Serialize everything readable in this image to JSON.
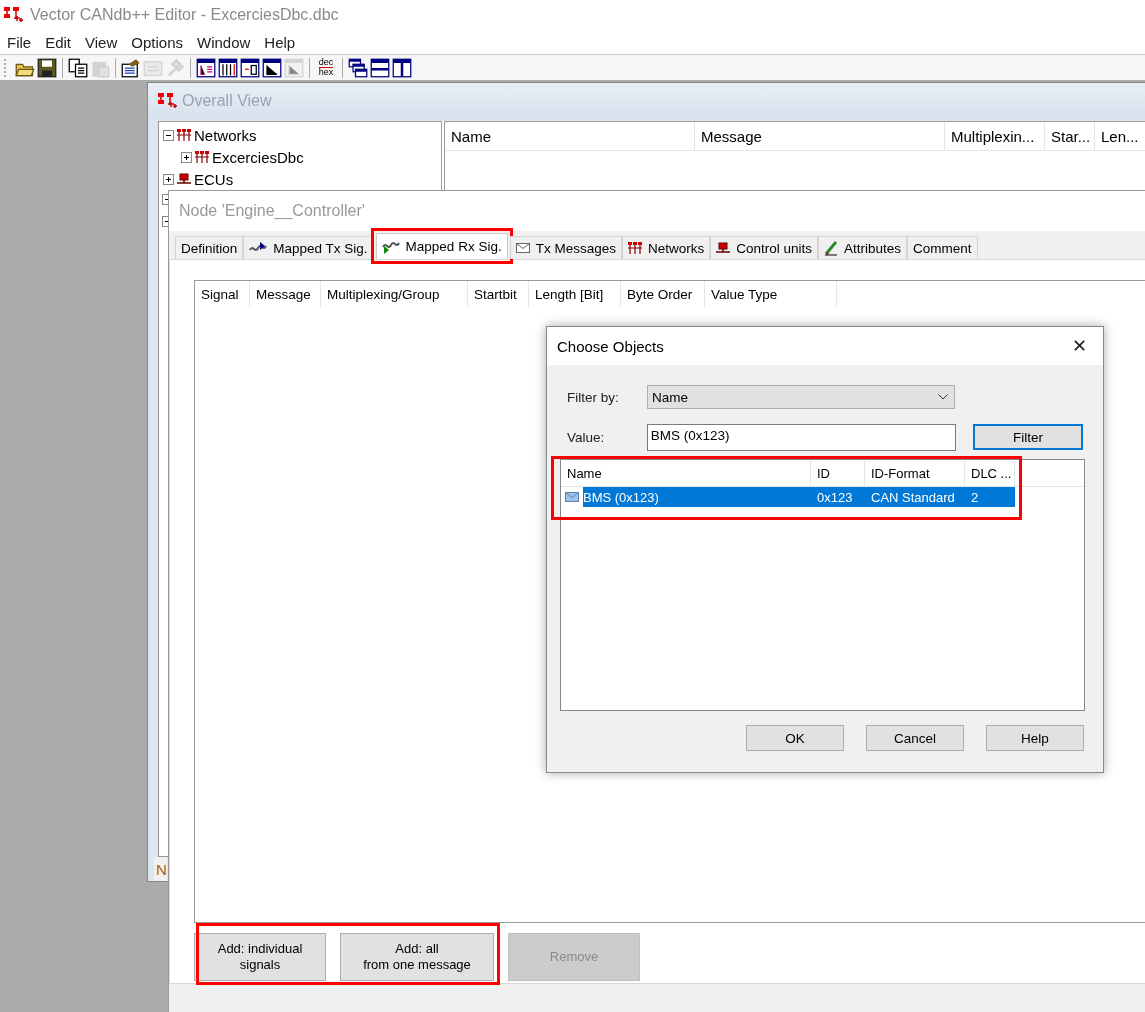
{
  "app_window": {
    "title": "Vector CANdb++ Editor - ExcerciesDbc.dbc"
  },
  "menu": [
    "File",
    "Edit",
    "View",
    "Options",
    "Window",
    "Help"
  ],
  "toolbar": {
    "groups": [
      [
        {
          "disabled": false
        },
        {
          "disabled": false
        }
      ],
      [
        {
          "disabled": false
        },
        {
          "disabled": true
        }
      ],
      [
        {
          "disabled": false
        },
        {
          "disabled": true
        },
        {
          "disabled": true
        }
      ],
      [
        {
          "disabled": false
        },
        {
          "disabled": false
        },
        {
          "disabled": false
        },
        {
          "disabled": false
        },
        {
          "disabled": true
        }
      ],
      [
        {
          "label_top": "dec",
          "label_bottom": "hex",
          "disabled": false
        }
      ],
      [
        {
          "disabled": false
        },
        {
          "disabled": false
        },
        {
          "disabled": false
        }
      ]
    ]
  },
  "overall_view": {
    "title": "Overall View",
    "tree": [
      {
        "label": "Networks",
        "expanded": true,
        "children": [
          {
            "label": "ExcerciesDbc",
            "expanded": false
          }
        ]
      },
      {
        "label": "ECUs",
        "expanded": false
      }
    ],
    "columns": [
      "Name",
      "Message",
      "Multiplexin...",
      "Star...",
      "Len..."
    ],
    "bottom_tab": "N"
  },
  "node_window": {
    "title": "Node 'Engine__Controller'",
    "tabs": [
      {
        "label": "Definition",
        "selected": false,
        "highlighted": false
      },
      {
        "label": "Mapped Tx Sig.",
        "selected": false,
        "highlighted": false
      },
      {
        "label": "Mapped Rx Sig.",
        "selected": true,
        "highlighted": true
      },
      {
        "label": "Tx Messages",
        "selected": false,
        "highlighted": false
      },
      {
        "label": "Networks",
        "selected": false,
        "highlighted": false
      },
      {
        "label": "Control units",
        "selected": false,
        "highlighted": false
      },
      {
        "label": "Attributes",
        "selected": false,
        "highlighted": false
      },
      {
        "label": "Comment",
        "selected": false,
        "highlighted": false
      }
    ],
    "columns": [
      "Signal",
      "Message",
      "Multiplexing/Group",
      "Startbit",
      "Length [Bit]",
      "Byte Order",
      "Value Type"
    ],
    "buttons": [
      {
        "label": "Add: individual\nsignals",
        "disabled": false,
        "highlighted": true
      },
      {
        "label": "Add: all\nfrom one message",
        "disabled": false,
        "highlighted": true
      },
      {
        "label": "Remove",
        "disabled": true,
        "highlighted": false
      }
    ]
  },
  "dialog": {
    "title": "Choose Objects",
    "close": "✕",
    "filter_by": {
      "label": "Filter by:",
      "value": "Name"
    },
    "value_field": {
      "label": "Value:",
      "value": "BMS (0x123)"
    },
    "filter_button": "Filter",
    "list": {
      "highlighted": true,
      "columns": [
        "Name",
        "ID",
        "ID-Format",
        "DLC ..."
      ],
      "rows": [
        {
          "cells": [
            "BMS (0x123)",
            "0x123",
            "CAN Standard",
            "2"
          ],
          "selected": true
        }
      ]
    },
    "buttons": [
      "OK",
      "Cancel",
      "Help"
    ]
  }
}
